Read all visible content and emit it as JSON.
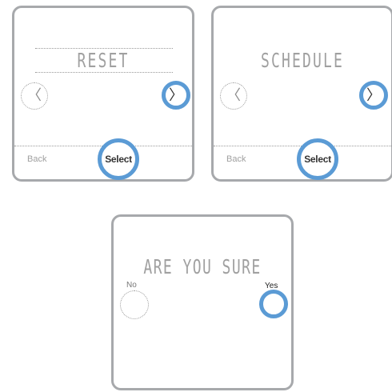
{
  "screens": [
    {
      "title": "RESET",
      "prev_icon": "chevron-left-icon",
      "next_icon": "chevron-right-icon",
      "prev_glyph": "〈",
      "next_glyph": "〉",
      "back_label": "Back",
      "select_label": "Select"
    },
    {
      "title": "SCHEDULE",
      "prev_icon": "chevron-left-icon",
      "next_icon": "chevron-right-icon",
      "prev_glyph": "〈",
      "next_glyph": "〉",
      "back_label": "Back",
      "select_label": "Select"
    },
    {
      "title": "ARE YOU SURE",
      "no_label": "No",
      "yes_label": "Yes"
    }
  ],
  "colors": {
    "highlight": "#5b9bd5",
    "frame": "#a7a9ac",
    "segment_text": "#a0a0a0"
  }
}
